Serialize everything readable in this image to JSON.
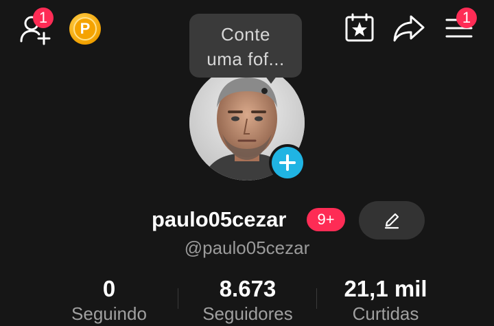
{
  "header": {
    "add_friend_badge": "1",
    "coin_letter": "P",
    "menu_badge": "1"
  },
  "tooltip": {
    "text_line1": "Conte",
    "text_line2": "uma fof..."
  },
  "profile": {
    "username": "paulo05cezar",
    "notification_badge": "9+",
    "handle": "@paulo05cezar"
  },
  "stats": [
    {
      "value": "0",
      "label": "Seguindo"
    },
    {
      "value": "8.673",
      "label": "Seguidores"
    },
    {
      "value": "21,1 mil",
      "label": "Curtidas"
    }
  ],
  "colors": {
    "background": "#161616",
    "badge": "#fe2c55",
    "add_button": "#20b4e3",
    "coin": "#f5a300"
  },
  "icons": [
    "add-friend-icon",
    "coin-icon",
    "calendar-star-icon",
    "share-icon",
    "menu-icon",
    "plus-icon",
    "edit-pencil-icon"
  ]
}
